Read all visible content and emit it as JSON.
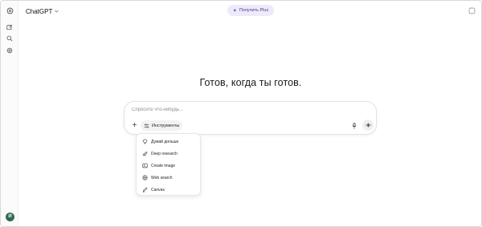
{
  "header": {
    "model_name": "ChatGPT",
    "upgrade_label": "Получить Plus"
  },
  "sidebar": {
    "avatar_initial": "И",
    "icons": [
      "edit-icon",
      "search-icon",
      "gpts-icon"
    ]
  },
  "main": {
    "headline": "Готов, когда ты готов."
  },
  "composer": {
    "placeholder": "Спросите что-нибудь...",
    "value": "",
    "tools_label": "Инструменты"
  },
  "tools_menu": {
    "items": [
      {
        "label": "Думай дольше",
        "icon": "lightbulb-icon"
      },
      {
        "label": "Deep research",
        "icon": "telescope-icon"
      },
      {
        "label": "Create image",
        "icon": "image-icon"
      },
      {
        "label": "Web search",
        "icon": "globe-icon"
      },
      {
        "label": "Canvas",
        "icon": "pen-icon"
      }
    ]
  },
  "colors": {
    "accent_upgrade_bg": "#eeeaf9",
    "accent_upgrade_fg": "#4b3a8f",
    "avatar_bg": "#2f6b4f"
  }
}
